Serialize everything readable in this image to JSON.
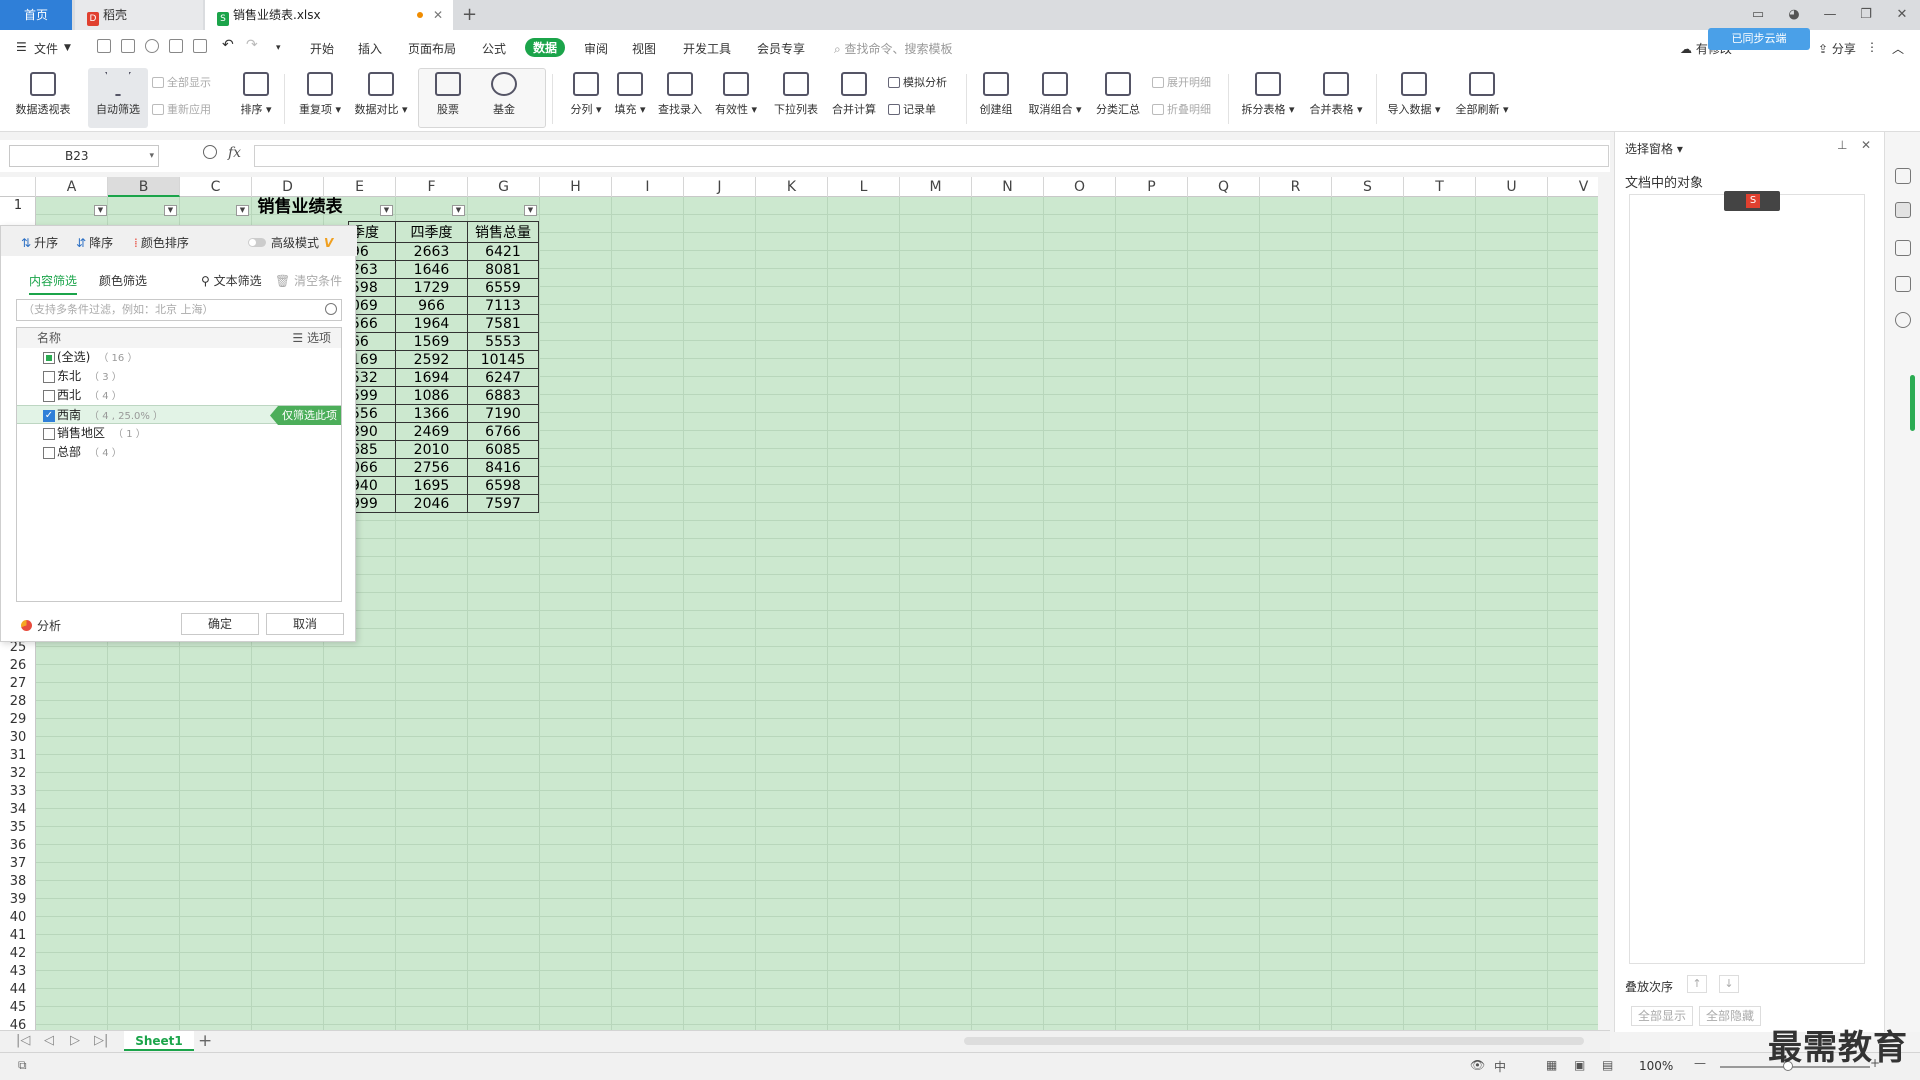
{
  "tabs": {
    "home": "首页",
    "draft": "稻壳",
    "file": "销售业绩表.xlsx"
  },
  "menu": {
    "file": "文件",
    "items": [
      "开始",
      "插入",
      "页面布局",
      "公式",
      "数据",
      "审阅",
      "视图",
      "开发工具",
      "会员专享"
    ],
    "active_index": 4,
    "search": "查找命令、搜索模板",
    "share": "分享",
    "unsynced": "有修改",
    "badge": "已同步云端"
  },
  "ribbon": {
    "pivot": "数据透视表",
    "autofilter": "自动筛选",
    "show_all": "全部显示",
    "reapply": "重新应用",
    "sort": "排序",
    "dup": "重复项",
    "compare": "数据对比",
    "stock": "股票",
    "fund": "基金",
    "split": "分列",
    "fill": "填充",
    "lookup": "查找录入",
    "validity": "有效性",
    "dropdown": "下拉列表",
    "consolidate": "合并计算",
    "simulate": "模拟分析",
    "record": "记录单",
    "group": "创建组",
    "ungroup": "取消组合",
    "subtotal": "分类汇总",
    "expand": "展开明细",
    "collapse": "折叠明细",
    "split_table": "拆分表格",
    "merge_table": "合并表格",
    "import": "导入数据",
    "refresh": "全部刷新"
  },
  "formula": {
    "cell_ref": "B23",
    "fx": "fx",
    "value": ""
  },
  "columns": [
    "A",
    "B",
    "C",
    "D",
    "E",
    "F",
    "G",
    "H",
    "I",
    "J",
    "K",
    "L",
    "M",
    "N",
    "O",
    "P",
    "Q",
    "R",
    "S",
    "T",
    "U",
    "V"
  ],
  "selected_column": "B",
  "rows_top": [
    "1"
  ],
  "rows_bottom": [
    "25",
    "26",
    "27",
    "28",
    "29",
    "30",
    "31",
    "32",
    "33",
    "34",
    "35",
    "36",
    "37",
    "38",
    "39",
    "40",
    "41",
    "42",
    "43",
    "44",
    "45",
    "46"
  ],
  "sheet": {
    "title": "销售业绩表",
    "headers": [
      "季度",
      "四季度",
      "销售总量"
    ],
    "rows": [
      [
        "96",
        "2663",
        "6421"
      ],
      [
        "263",
        "1646",
        "8081"
      ],
      [
        "598",
        "1729",
        "6559"
      ],
      [
        "069",
        "966",
        "7113"
      ],
      [
        "566",
        "1964",
        "7581"
      ],
      [
        "66",
        "1569",
        "5553"
      ],
      [
        "169",
        "2592",
        "10145"
      ],
      [
        "532",
        "1694",
        "6247"
      ],
      [
        "599",
        "1086",
        "6883"
      ],
      [
        "556",
        "1366",
        "7190"
      ],
      [
        "390",
        "2469",
        "6766"
      ],
      [
        "685",
        "2010",
        "6085"
      ],
      [
        "066",
        "2756",
        "8416"
      ],
      [
        "940",
        "1695",
        "6598"
      ],
      [
        "999",
        "2046",
        "7597"
      ]
    ]
  },
  "filter": {
    "asc": "升序",
    "desc": "降序",
    "color_sort": "颜色排序",
    "advanced": "高级模式",
    "tab_content": "内容筛选",
    "tab_color": "颜色筛选",
    "text_filter": "文本筛选",
    "clear": "清空条件",
    "search_placeholder": "（支持多条件过滤，例如：北京 上海）",
    "list_header": "名称",
    "options": "选项",
    "items": [
      {
        "label": "(全选)",
        "count": "（ 16 ）",
        "state": "partial"
      },
      {
        "label": "东北",
        "count": "（ 3 ）",
        "state": "off"
      },
      {
        "label": "西北",
        "count": "（ 4 ）",
        "state": "off"
      },
      {
        "label": "西南",
        "count": "（ 4 , 25.0% ）",
        "state": "on"
      },
      {
        "label": "销售地区",
        "count": "（ 1 ）",
        "state": "off"
      },
      {
        "label": "总部",
        "count": "（ 4 ）",
        "state": "off"
      }
    ],
    "only_this": "仅筛选此项",
    "analyze": "分析",
    "ok": "确定",
    "cancel": "取消"
  },
  "panel": {
    "title": "选择窗格",
    "objects": "文档中的对象",
    "order": "叠放次序",
    "show_all": "全部显示",
    "hide_all": "全部隐藏"
  },
  "sheetbar": {
    "tab": "Sheet1"
  },
  "status": {
    "zoom": "100%"
  },
  "watermark": "最需教育",
  "colors": {
    "accent": "#1ba44a",
    "grid_bg": "#cce8cf",
    "tab_home": "#2f7fd8"
  }
}
